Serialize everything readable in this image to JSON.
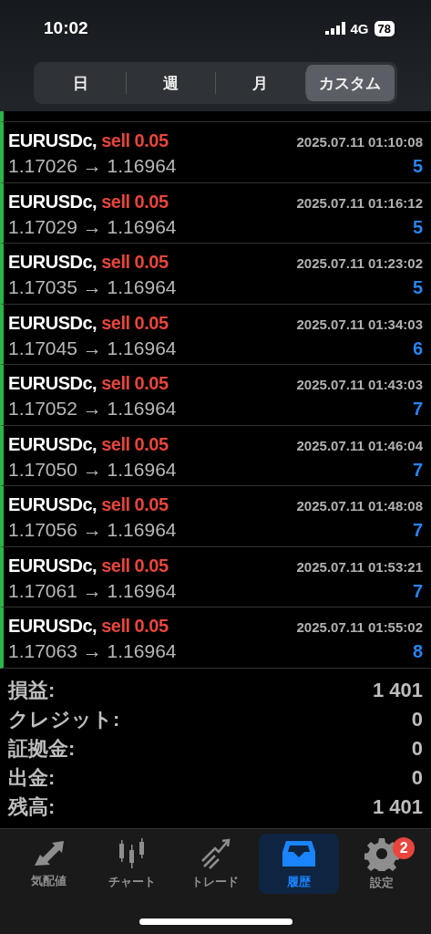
{
  "status_bar": {
    "time": "10:02",
    "network": "4G",
    "battery": "78"
  },
  "tabs": [
    {
      "label": "日",
      "selected": false
    },
    {
      "label": "週",
      "selected": false
    },
    {
      "label": "月",
      "selected": false
    },
    {
      "label": "カスタム",
      "selected": true
    }
  ],
  "deals": [
    {
      "symbol": "EURUSDc,",
      "action": "sell 0.05",
      "time": "2025.07.11 01:10:08",
      "prices": "1.17026 → 1.16964",
      "profit": "5"
    },
    {
      "symbol": "EURUSDc,",
      "action": "sell 0.05",
      "time": "2025.07.11 01:16:12",
      "prices": "1.17029 → 1.16964",
      "profit": "5"
    },
    {
      "symbol": "EURUSDc,",
      "action": "sell 0.05",
      "time": "2025.07.11 01:23:02",
      "prices": "1.17035 → 1.16964",
      "profit": "5"
    },
    {
      "symbol": "EURUSDc,",
      "action": "sell 0.05",
      "time": "2025.07.11 01:34:03",
      "prices": "1.17045 → 1.16964",
      "profit": "6"
    },
    {
      "symbol": "EURUSDc,",
      "action": "sell 0.05",
      "time": "2025.07.11 01:43:03",
      "prices": "1.17052 → 1.16964",
      "profit": "7"
    },
    {
      "symbol": "EURUSDc,",
      "action": "sell 0.05",
      "time": "2025.07.11 01:46:04",
      "prices": "1.17050 → 1.16964",
      "profit": "7"
    },
    {
      "symbol": "EURUSDc,",
      "action": "sell 0.05",
      "time": "2025.07.11 01:48:08",
      "prices": "1.17056 → 1.16964",
      "profit": "7"
    },
    {
      "symbol": "EURUSDc,",
      "action": "sell 0.05",
      "time": "2025.07.11 01:53:21",
      "prices": "1.17061 → 1.16964",
      "profit": "7"
    },
    {
      "symbol": "EURUSDc,",
      "action": "sell 0.05",
      "time": "2025.07.11 01:55:02",
      "prices": "1.17063 → 1.16964",
      "profit": "8"
    }
  ],
  "summary": [
    {
      "label": "損益:",
      "value": "1 401"
    },
    {
      "label": "クレジット:",
      "value": "0"
    },
    {
      "label": "証拠金:",
      "value": "0"
    },
    {
      "label": "出金:",
      "value": "0"
    },
    {
      "label": "残高:",
      "value": "1 401"
    }
  ],
  "nav": [
    {
      "kind": "quotes",
      "label": "気配値",
      "selected": false
    },
    {
      "kind": "chart",
      "label": "チャート",
      "selected": false
    },
    {
      "kind": "trade",
      "label": "トレード",
      "selected": false
    },
    {
      "kind": "history",
      "label": "履歴",
      "selected": true
    },
    {
      "kind": "settings",
      "label": "設定",
      "selected": false,
      "badge": "2"
    }
  ]
}
